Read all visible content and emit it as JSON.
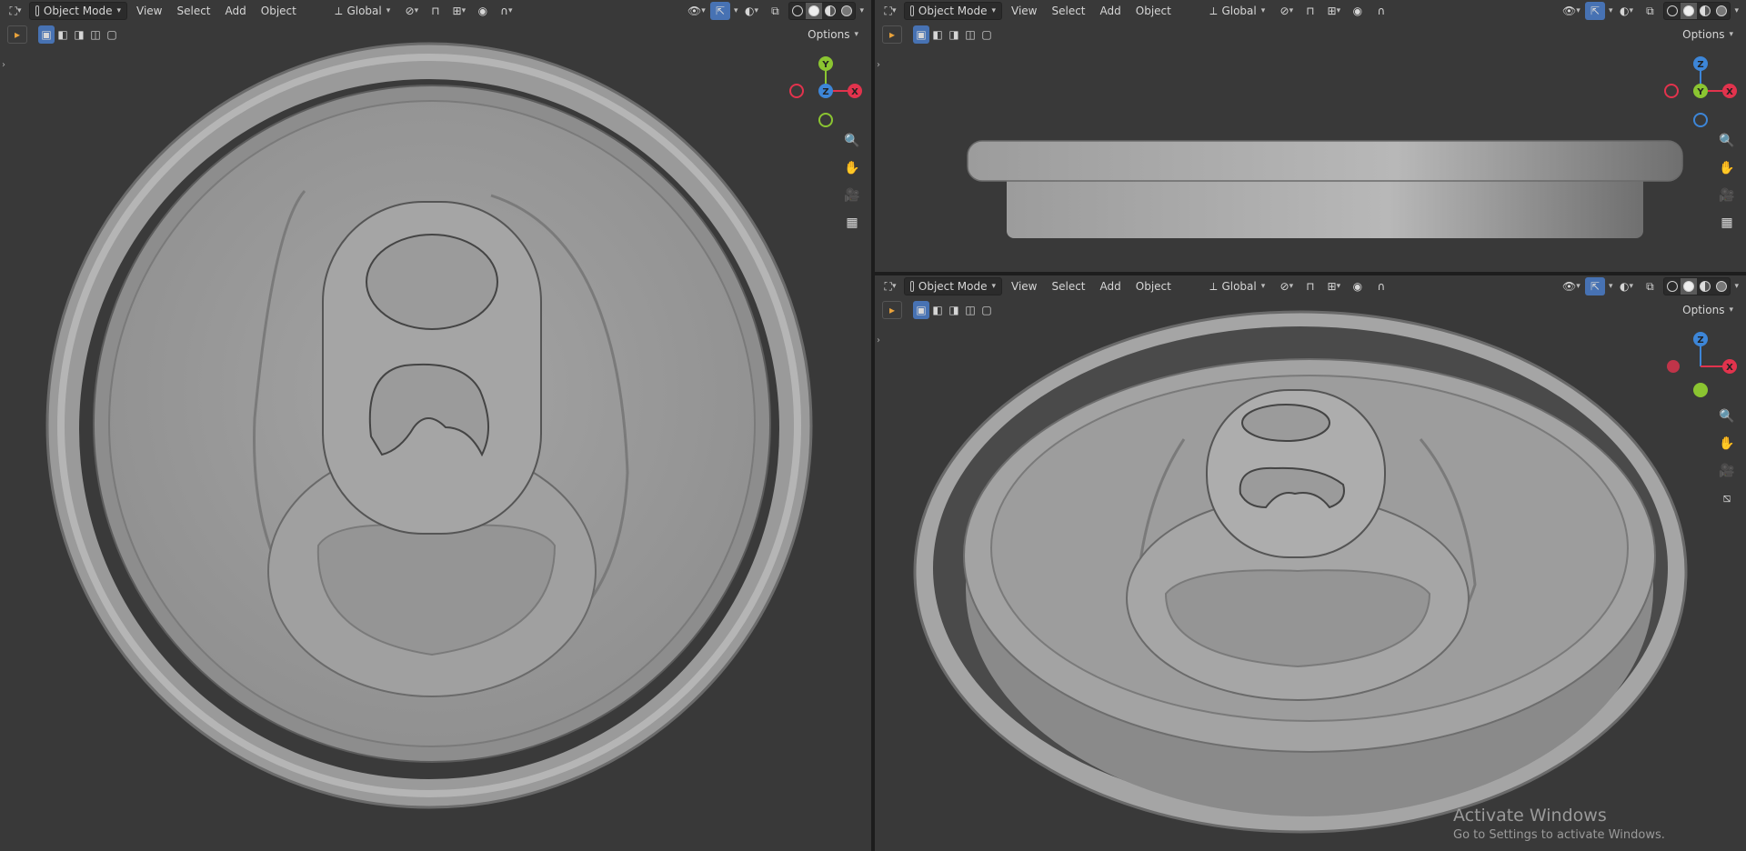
{
  "header": {
    "mode_label": "Object Mode",
    "menus": [
      "View",
      "Select",
      "Add",
      "Object"
    ],
    "transform_orientation": "Global",
    "options_label": "Options"
  },
  "viewports": [
    {
      "name": "top",
      "gizmo_center_axis": "Z",
      "gizmo_up": "Y",
      "gizmo_right": "X"
    },
    {
      "name": "front",
      "gizmo_center_axis": "Y",
      "gizmo_up": "Z",
      "gizmo_right": "X"
    },
    {
      "name": "perspective",
      "gizmo_up": "Z",
      "gizmo_right": "X"
    }
  ],
  "icons": [
    "editor-type-icon",
    "object-mode-icon",
    "orientation-icon",
    "pivot-icon",
    "snap-icon",
    "proportional-icon",
    "visibility-icon",
    "gizmo-icon",
    "overlay-icon",
    "xray-icon",
    "wireframe-icon",
    "solid-icon",
    "material-icon",
    "rendered-icon",
    "zoom-icon",
    "hand-icon",
    "camera-icon",
    "grid-icon"
  ],
  "colors": {
    "x_axis": "#e2334d",
    "y_axis": "#8bc531",
    "z_axis": "#3d86d8",
    "viewport_bg": "#393939",
    "active_btn": "#4772b3"
  },
  "watermark": {
    "title": "Activate Windows",
    "subtitle": "Go to Settings to activate Windows."
  }
}
